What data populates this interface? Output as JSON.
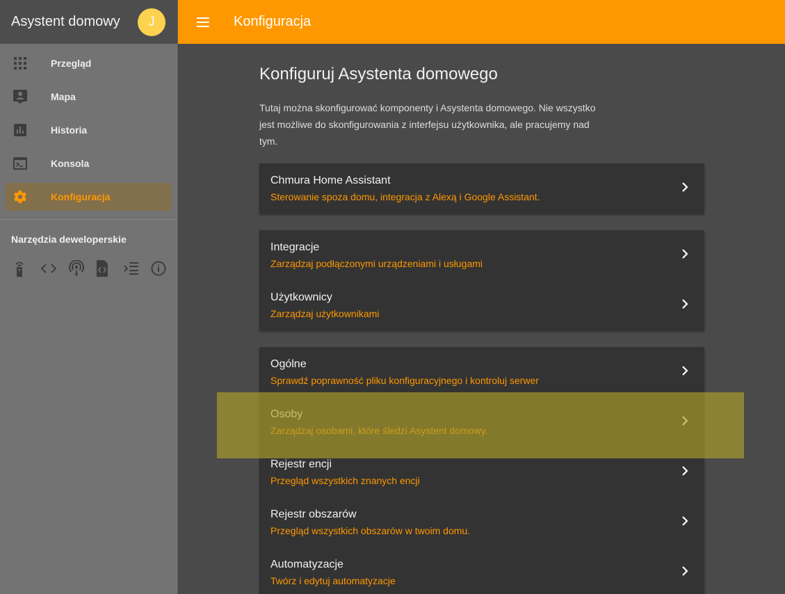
{
  "sidebar": {
    "title": "Asystent domowy",
    "avatar_letter": "J",
    "items": [
      {
        "label": "Przegląd",
        "icon": "grid-icon"
      },
      {
        "label": "Mapa",
        "icon": "account-box-icon"
      },
      {
        "label": "Historia",
        "icon": "chart-icon"
      },
      {
        "label": "Konsola",
        "icon": "console-icon"
      },
      {
        "label": "Konfiguracja",
        "icon": "gear-icon"
      }
    ],
    "dev_title": "Narzędzia deweloperskie",
    "dev_tools": [
      "remote-icon",
      "code-icon",
      "broadcast-icon",
      "file-code-icon",
      "template-icon",
      "info-icon"
    ]
  },
  "topbar": {
    "title": "Konfiguracja"
  },
  "main": {
    "heading": "Konfiguruj Asystenta domowego",
    "description": "Tutaj można skonfigurować komponenty i Asystenta domowego. Nie wszystko jest możliwe do skonfigurowania z interfejsu użytkownika, ale pracujemy nad tym.",
    "cards": [
      {
        "rows": [
          {
            "title": "Chmura Home Assistant",
            "subtitle": "Sterowanie spoza domu, integracja z Alexą i Google Assistant."
          }
        ]
      },
      {
        "rows": [
          {
            "title": "Integracje",
            "subtitle": "Zarządzaj podłączonymi urządzeniami i usługami"
          },
          {
            "title": "Użytkownicy",
            "subtitle": "Zarządzaj użytkownikami"
          }
        ]
      },
      {
        "rows": [
          {
            "title": "Ogólne",
            "subtitle": "Sprawdź poprawność pliku konfiguracyjnego i kontroluj serwer"
          },
          {
            "title": "Osoby",
            "subtitle": "Zarządzaj osobami, które śledzi Asystent domowy."
          },
          {
            "title": "Rejestr encji",
            "subtitle": "Przegląd wszystkich znanych encji"
          },
          {
            "title": "Rejestr obszarów",
            "subtitle": "Przegląd wszystkich obszarów w twoim domu."
          },
          {
            "title": "Automatyzacje",
            "subtitle": "Twórz i edytuj automatyzacje"
          }
        ]
      }
    ]
  },
  "colors": {
    "accent": "#ff9800",
    "sidebar_bg": "#737373",
    "card_bg": "#333333",
    "highlight": "#afa02a"
  }
}
